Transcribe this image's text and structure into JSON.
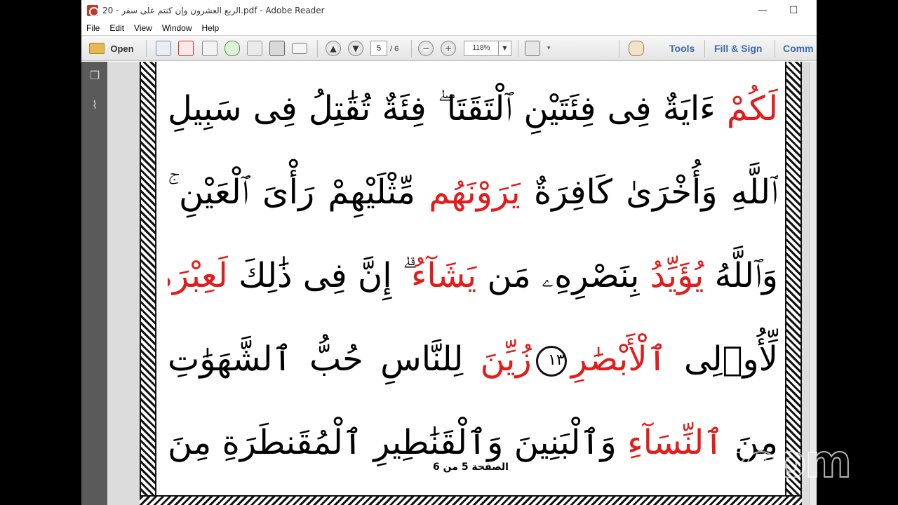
{
  "window": {
    "title": "الربع العشرون  وإن كنتم على سفر - 20.pdf - Adobe Reader",
    "minimize": "—",
    "maximize": "☐"
  },
  "menu": [
    "File",
    "Edit",
    "View",
    "Window",
    "Help"
  ],
  "toolbar": {
    "open_label": "Open",
    "page_current": "5",
    "page_total": "/ 6",
    "zoom_value": "118%",
    "tools_label": "Tools",
    "fill_sign_label": "Fill & Sign",
    "comment_label": "Comm"
  },
  "document": {
    "lines": [
      [
        "لَكُمْ",
        " ءَايَةٌ فِى فِئَتَيْنِ ٱلْتَقَتَا ۖ فِئَةٌ تُقَٰتِلُ فِى سَبِيلِ"
      ],
      [
        "ٱللَّهِ وَأُخْرَىٰ كَافِرَةٌ ",
        "يَرَوْنَهُم",
        " مِّثْلَيْهِمْ رَأْىَ ٱلْعَيْنِ ۚ"
      ],
      [
        "وَٱللَّهُ ",
        "يُؤَيِّدُ",
        " بِنَصْرِهِۦ مَن ",
        "يَشَآءُ",
        " ۗ إِنَّ فِى ذَٰلِكَ ",
        "لَعِبْرَةً"
      ],
      [
        "لِّأُو۟لِى ",
        "ٱلْأَبْصَٰرِ",
        "١٣",
        "زُيِّنَ",
        " لِلنَّاسِ حُبُّ ٱلشَّهَوَٰتِ"
      ],
      [
        "مِنَ ",
        "ٱلنِّسَآءِ",
        " وَٱلْبَنِينَ وَٱلْقَنَٰطِيرِ ٱلْمُقَنطَرَةِ مِنَ"
      ]
    ],
    "page_footer": "الصفحة 5 من 6"
  },
  "watermark": "zoom"
}
